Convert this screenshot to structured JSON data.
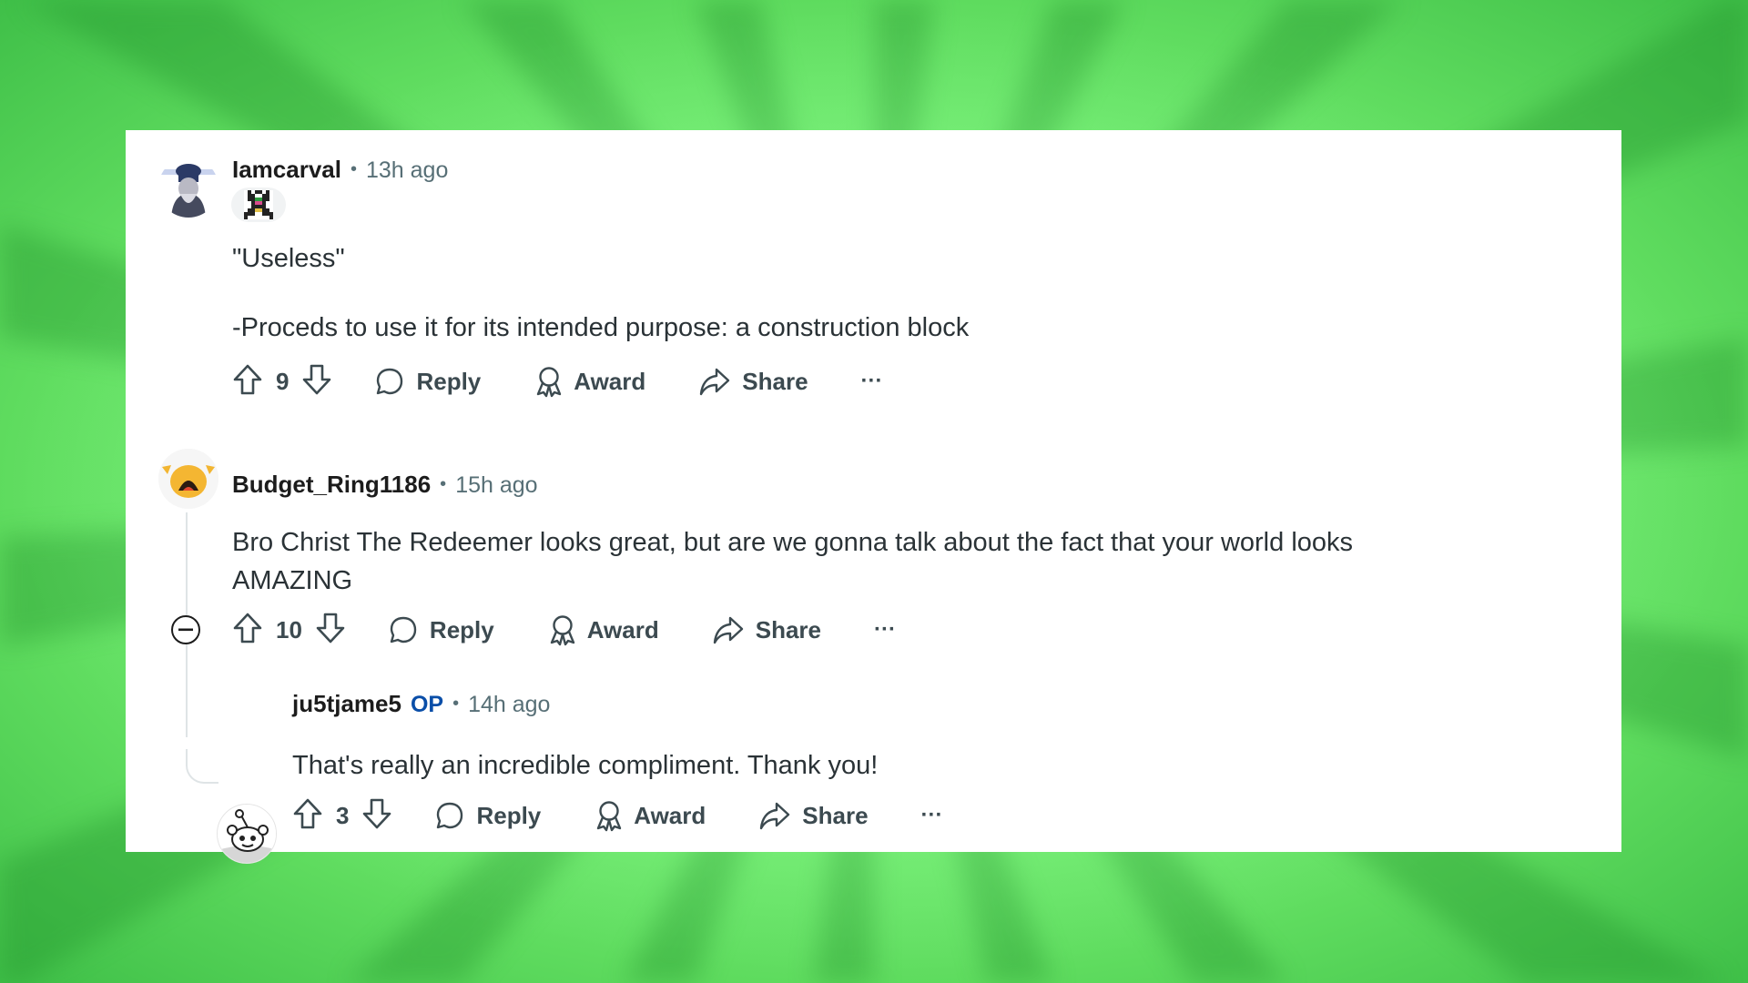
{
  "comments": [
    {
      "username": "Iamcarval",
      "op_label": "",
      "time": "13h ago",
      "body": [
        "\"Useless\"",
        "-Proceds to use it for its intended purpose: a construction block"
      ],
      "votes": "9",
      "actions": {
        "reply": "Reply",
        "award": "Award",
        "share": "Share",
        "more": "···"
      }
    },
    {
      "username": "Budget_Ring1186",
      "op_label": "",
      "time": "15h ago",
      "body": [
        "Bro Christ The Redeemer looks great, but are we gonna talk about the fact that your world looks",
        "AMAZING"
      ],
      "votes": "10",
      "actions": {
        "reply": "Reply",
        "award": "Award",
        "share": "Share",
        "more": "···"
      }
    },
    {
      "username": "ju5tjame5",
      "op_label": "OP",
      "time": "14h ago",
      "body": [
        "That's really an incredible compliment. Thank you!"
      ],
      "votes": "3",
      "actions": {
        "reply": "Reply",
        "award": "Award",
        "share": "Share",
        "more": "···"
      }
    }
  ],
  "icons": {
    "upvote": "arrow-up-icon",
    "downvote": "arrow-down-icon",
    "reply": "speech-bubble-icon",
    "award": "award-ribbon-icon",
    "share": "share-arrow-icon",
    "more": "more-dots-icon",
    "collapse": "collapse-minus-icon"
  },
  "colors": {
    "background_green": "#7df27d",
    "card": "#ffffff",
    "op": "#0a4ea8",
    "meta": "#576f76",
    "text": "#2a3236"
  }
}
